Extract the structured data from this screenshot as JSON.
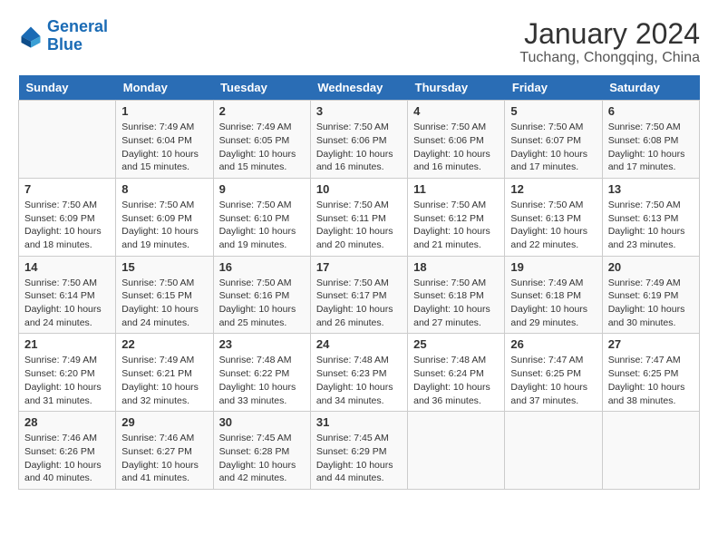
{
  "header": {
    "logo_line1": "General",
    "logo_line2": "Blue",
    "month_year": "January 2024",
    "location": "Tuchang, Chongqing, China"
  },
  "days_of_week": [
    "Sunday",
    "Monday",
    "Tuesday",
    "Wednesday",
    "Thursday",
    "Friday",
    "Saturday"
  ],
  "weeks": [
    [
      {
        "day": "",
        "info": ""
      },
      {
        "day": "1",
        "info": "Sunrise: 7:49 AM\nSunset: 6:04 PM\nDaylight: 10 hours\nand 15 minutes."
      },
      {
        "day": "2",
        "info": "Sunrise: 7:49 AM\nSunset: 6:05 PM\nDaylight: 10 hours\nand 15 minutes."
      },
      {
        "day": "3",
        "info": "Sunrise: 7:50 AM\nSunset: 6:06 PM\nDaylight: 10 hours\nand 16 minutes."
      },
      {
        "day": "4",
        "info": "Sunrise: 7:50 AM\nSunset: 6:06 PM\nDaylight: 10 hours\nand 16 minutes."
      },
      {
        "day": "5",
        "info": "Sunrise: 7:50 AM\nSunset: 6:07 PM\nDaylight: 10 hours\nand 17 minutes."
      },
      {
        "day": "6",
        "info": "Sunrise: 7:50 AM\nSunset: 6:08 PM\nDaylight: 10 hours\nand 17 minutes."
      }
    ],
    [
      {
        "day": "7",
        "info": "Sunrise: 7:50 AM\nSunset: 6:09 PM\nDaylight: 10 hours\nand 18 minutes."
      },
      {
        "day": "8",
        "info": "Sunrise: 7:50 AM\nSunset: 6:09 PM\nDaylight: 10 hours\nand 19 minutes."
      },
      {
        "day": "9",
        "info": "Sunrise: 7:50 AM\nSunset: 6:10 PM\nDaylight: 10 hours\nand 19 minutes."
      },
      {
        "day": "10",
        "info": "Sunrise: 7:50 AM\nSunset: 6:11 PM\nDaylight: 10 hours\nand 20 minutes."
      },
      {
        "day": "11",
        "info": "Sunrise: 7:50 AM\nSunset: 6:12 PM\nDaylight: 10 hours\nand 21 minutes."
      },
      {
        "day": "12",
        "info": "Sunrise: 7:50 AM\nSunset: 6:13 PM\nDaylight: 10 hours\nand 22 minutes."
      },
      {
        "day": "13",
        "info": "Sunrise: 7:50 AM\nSunset: 6:13 PM\nDaylight: 10 hours\nand 23 minutes."
      }
    ],
    [
      {
        "day": "14",
        "info": "Sunrise: 7:50 AM\nSunset: 6:14 PM\nDaylight: 10 hours\nand 24 minutes."
      },
      {
        "day": "15",
        "info": "Sunrise: 7:50 AM\nSunset: 6:15 PM\nDaylight: 10 hours\nand 24 minutes."
      },
      {
        "day": "16",
        "info": "Sunrise: 7:50 AM\nSunset: 6:16 PM\nDaylight: 10 hours\nand 25 minutes."
      },
      {
        "day": "17",
        "info": "Sunrise: 7:50 AM\nSunset: 6:17 PM\nDaylight: 10 hours\nand 26 minutes."
      },
      {
        "day": "18",
        "info": "Sunrise: 7:50 AM\nSunset: 6:18 PM\nDaylight: 10 hours\nand 27 minutes."
      },
      {
        "day": "19",
        "info": "Sunrise: 7:49 AM\nSunset: 6:18 PM\nDaylight: 10 hours\nand 29 minutes."
      },
      {
        "day": "20",
        "info": "Sunrise: 7:49 AM\nSunset: 6:19 PM\nDaylight: 10 hours\nand 30 minutes."
      }
    ],
    [
      {
        "day": "21",
        "info": "Sunrise: 7:49 AM\nSunset: 6:20 PM\nDaylight: 10 hours\nand 31 minutes."
      },
      {
        "day": "22",
        "info": "Sunrise: 7:49 AM\nSunset: 6:21 PM\nDaylight: 10 hours\nand 32 minutes."
      },
      {
        "day": "23",
        "info": "Sunrise: 7:48 AM\nSunset: 6:22 PM\nDaylight: 10 hours\nand 33 minutes."
      },
      {
        "day": "24",
        "info": "Sunrise: 7:48 AM\nSunset: 6:23 PM\nDaylight: 10 hours\nand 34 minutes."
      },
      {
        "day": "25",
        "info": "Sunrise: 7:48 AM\nSunset: 6:24 PM\nDaylight: 10 hours\nand 36 minutes."
      },
      {
        "day": "26",
        "info": "Sunrise: 7:47 AM\nSunset: 6:25 PM\nDaylight: 10 hours\nand 37 minutes."
      },
      {
        "day": "27",
        "info": "Sunrise: 7:47 AM\nSunset: 6:25 PM\nDaylight: 10 hours\nand 38 minutes."
      }
    ],
    [
      {
        "day": "28",
        "info": "Sunrise: 7:46 AM\nSunset: 6:26 PM\nDaylight: 10 hours\nand 40 minutes."
      },
      {
        "day": "29",
        "info": "Sunrise: 7:46 AM\nSunset: 6:27 PM\nDaylight: 10 hours\nand 41 minutes."
      },
      {
        "day": "30",
        "info": "Sunrise: 7:45 AM\nSunset: 6:28 PM\nDaylight: 10 hours\nand 42 minutes."
      },
      {
        "day": "31",
        "info": "Sunrise: 7:45 AM\nSunset: 6:29 PM\nDaylight: 10 hours\nand 44 minutes."
      },
      {
        "day": "",
        "info": ""
      },
      {
        "day": "",
        "info": ""
      },
      {
        "day": "",
        "info": ""
      }
    ]
  ]
}
